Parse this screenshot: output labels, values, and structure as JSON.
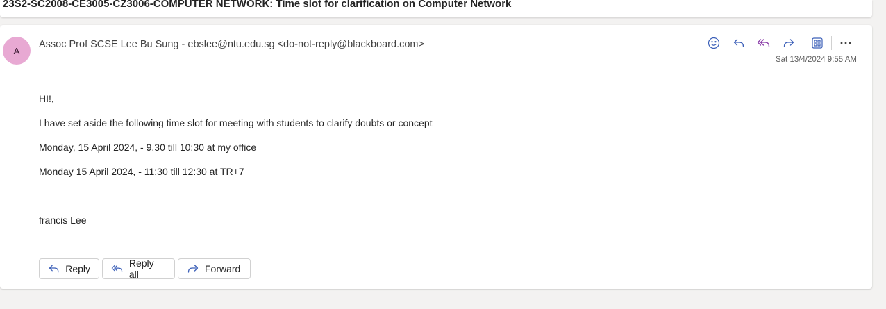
{
  "subject": "23S2-SC2008-CE3005-CZ3006-COMPUTER NETWORK: Time slot for clarification on Computer Network",
  "message": {
    "avatar_initial": "A",
    "sender": "Assoc Prof SCSE Lee Bu Sung - ebslee@ntu.edu.sg <do-not-reply@blackboard.com>",
    "date": "Sat 13/4/2024 9:55 AM",
    "body": {
      "greeting": "HI!,",
      "line1": " I have set aside the following time slot for meeting with students to clarify doubts or concept",
      "line2": "Monday, 15 April 2024, - 9.30 till 10:30 at my office",
      "line3": "Monday 15 April 2024, - 11:30 till 12:30 at TR+7",
      "signature": "francis Lee"
    }
  },
  "toolbar_icons": [
    "emoji-icon",
    "reply-icon",
    "reply-all-icon",
    "forward-icon",
    "apps-icon",
    "more-icon"
  ],
  "buttons": {
    "reply": "Reply",
    "reply_all": "Reply all",
    "forward": "Forward"
  },
  "colors": {
    "accent": "#3b5fb8",
    "avatar_bg": "#e8a9d3",
    "page_bg": "#f3f2f1"
  }
}
